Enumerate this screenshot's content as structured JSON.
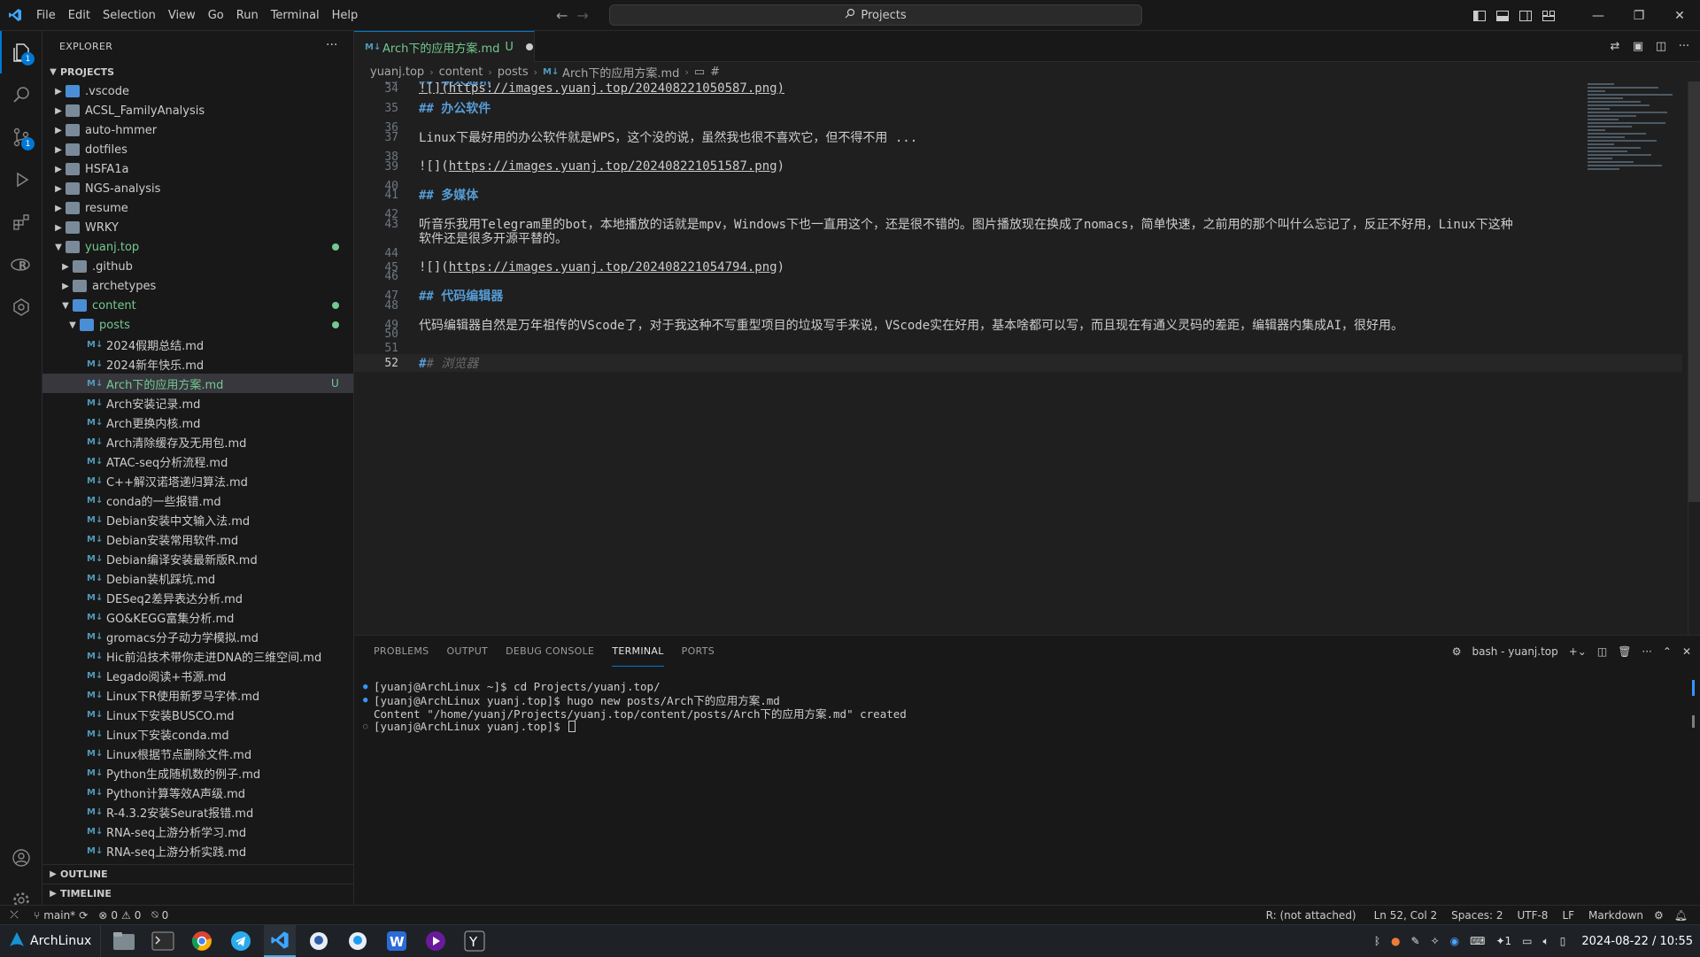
{
  "menu": [
    "File",
    "Edit",
    "Selection",
    "View",
    "Go",
    "Run",
    "Terminal",
    "Help"
  ],
  "command_center": "Projects",
  "explorer": {
    "title": "EXPLORER",
    "section": "PROJECTS",
    "items": [
      {
        "label": ".vscode",
        "type": "folder",
        "depth": 0,
        "open": false,
        "color": "blue"
      },
      {
        "label": "ACSL_FamilyAnalysis",
        "type": "folder",
        "depth": 0,
        "open": false
      },
      {
        "label": "auto-hmmer",
        "type": "folder",
        "depth": 0,
        "open": false
      },
      {
        "label": "dotfiles",
        "type": "folder",
        "depth": 0,
        "open": false
      },
      {
        "label": "HSFA1a",
        "type": "folder",
        "depth": 0,
        "open": false
      },
      {
        "label": "NGS-analysis",
        "type": "folder",
        "depth": 0,
        "open": false
      },
      {
        "label": "resume",
        "type": "folder",
        "depth": 0,
        "open": false
      },
      {
        "label": "WRKY",
        "type": "folder",
        "depth": 0,
        "open": false
      },
      {
        "label": "yuanj.top",
        "type": "folder",
        "depth": 0,
        "open": true,
        "git": true,
        "dot": true
      },
      {
        "label": ".github",
        "type": "folder",
        "depth": 1,
        "open": false
      },
      {
        "label": "archetypes",
        "type": "folder",
        "depth": 1,
        "open": false
      },
      {
        "label": "content",
        "type": "folder",
        "depth": 1,
        "open": true,
        "git": true,
        "dot": true,
        "color": "blue"
      },
      {
        "label": "posts",
        "type": "folder",
        "depth": 2,
        "open": true,
        "git": true,
        "dot": true,
        "color": "blue"
      },
      {
        "label": "2024假期总结.md",
        "type": "md",
        "depth": 3
      },
      {
        "label": "2024新年快乐.md",
        "type": "md",
        "depth": 3
      },
      {
        "label": "Arch下的应用方案.md",
        "type": "md",
        "depth": 3,
        "selected": true,
        "git": true,
        "status": "U"
      },
      {
        "label": "Arch安装记录.md",
        "type": "md",
        "depth": 3
      },
      {
        "label": "Arch更换内核.md",
        "type": "md",
        "depth": 3
      },
      {
        "label": "Arch清除缓存及无用包.md",
        "type": "md",
        "depth": 3
      },
      {
        "label": "ATAC-seq分析流程.md",
        "type": "md",
        "depth": 3
      },
      {
        "label": "C++解汉诺塔递归算法.md",
        "type": "md",
        "depth": 3
      },
      {
        "label": "conda的一些报错.md",
        "type": "md",
        "depth": 3
      },
      {
        "label": "Debian安装中文输入法.md",
        "type": "md",
        "depth": 3
      },
      {
        "label": "Debian安装常用软件.md",
        "type": "md",
        "depth": 3
      },
      {
        "label": "Debian编译安装最新版R.md",
        "type": "md",
        "depth": 3
      },
      {
        "label": "Debian装机踩坑.md",
        "type": "md",
        "depth": 3
      },
      {
        "label": "DESeq2差异表达分析.md",
        "type": "md",
        "depth": 3
      },
      {
        "label": "GO&KEGG富集分析.md",
        "type": "md",
        "depth": 3
      },
      {
        "label": "gromacs分子动力学模拟.md",
        "type": "md",
        "depth": 3
      },
      {
        "label": "Hic前沿技术带你走进DNA的三维空间.md",
        "type": "md",
        "depth": 3
      },
      {
        "label": "Legado阅读+书源.md",
        "type": "md",
        "depth": 3
      },
      {
        "label": "Linux下R使用新罗马字体.md",
        "type": "md",
        "depth": 3
      },
      {
        "label": "Linux下安装BUSCO.md",
        "type": "md",
        "depth": 3
      },
      {
        "label": "Linux下安装conda.md",
        "type": "md",
        "depth": 3
      },
      {
        "label": "Linux根据节点删除文件.md",
        "type": "md",
        "depth": 3
      },
      {
        "label": "Python生成随机数的例子.md",
        "type": "md",
        "depth": 3
      },
      {
        "label": "Python计算等效A声级.md",
        "type": "md",
        "depth": 3
      },
      {
        "label": "R-4.3.2安装Seurat报错.md",
        "type": "md",
        "depth": 3
      },
      {
        "label": "RNA-seq上游分析学习.md",
        "type": "md",
        "depth": 3
      },
      {
        "label": "RNA-seq上游分析实践.md",
        "type": "md",
        "depth": 3
      }
    ],
    "outline": "OUTLINE",
    "timeline": "TIMELINE"
  },
  "tab": {
    "label": "Arch下的应用方案.md",
    "status": "U"
  },
  "breadcrumb": [
    "yuanj.top",
    "content",
    "posts",
    "Arch下的应用方案.md",
    "#"
  ],
  "editor_lines": [
    {
      "n": "25",
      "segs": [
        {
          "t": "## 聊天通讯",
          "c": "hd"
        }
      ]
    },
    {
      "n": "34",
      "segs": [
        {
          "t": "![](https://images.yuanj.top/202408221050587.png)",
          "c": "lnk"
        }
      ]
    },
    {
      "n": "35",
      "segs": [
        {
          "t": "## 办公软件",
          "c": "hd"
        }
      ]
    },
    {
      "n": "36",
      "segs": []
    },
    {
      "n": "37",
      "segs": [
        {
          "t": "Linux下最好用的办公软件就是WPS，这个没的说，虽然我也很不喜欢它，但不得不用 ...",
          "c": ""
        }
      ]
    },
    {
      "n": "38",
      "segs": []
    },
    {
      "n": "39",
      "segs": [
        {
          "t": "![](",
          "c": ""
        },
        {
          "t": "https://images.yuanj.top/202408221051587.png",
          "c": "lnk"
        },
        {
          "t": ")",
          "c": ""
        }
      ]
    },
    {
      "n": "40",
      "segs": []
    },
    {
      "n": "41",
      "segs": [
        {
          "t": "## 多媒体",
          "c": "hd"
        }
      ]
    },
    {
      "n": "42",
      "segs": []
    },
    {
      "n": "43",
      "segs": [
        {
          "t": "听音乐我用Telegram里的bot，本地播放的话就是mpv，Windows下也一直用这个，还是很不错的。图片播放现在换成了nomacs，简单快速，之前用的那个叫什么忘记了，反正不好用，Linux下这种",
          "c": ""
        }
      ]
    },
    {
      "n": "",
      "segs": [
        {
          "t": "软件还是很多开源平替的。",
          "c": ""
        }
      ]
    },
    {
      "n": "44",
      "segs": []
    },
    {
      "n": "45",
      "segs": [
        {
          "t": "![](",
          "c": ""
        },
        {
          "t": "https://images.yuanj.top/202408221054794.png",
          "c": "lnk"
        },
        {
          "t": ")",
          "c": ""
        }
      ]
    },
    {
      "n": "46",
      "segs": []
    },
    {
      "n": "47",
      "segs": [
        {
          "t": "## 代码编辑器",
          "c": "hd"
        }
      ]
    },
    {
      "n": "48",
      "segs": []
    },
    {
      "n": "49",
      "segs": [
        {
          "t": "代码编辑器自然是万年祖传的VScode了，对于我这种不写重型项目的垃圾写手来说，VScode实在好用，基本啥都可以写，而且现在有通义灵码的差距，编辑器内集成AI，很好用。",
          "c": ""
        }
      ]
    },
    {
      "n": "50",
      "segs": []
    },
    {
      "n": "51",
      "segs": []
    },
    {
      "n": "52",
      "segs": [
        {
          "t": "#",
          "c": "hd"
        },
        {
          "t": "# 浏览器",
          "c": "ghost"
        }
      ],
      "current": true
    }
  ],
  "panel": {
    "tabs": [
      "PROBLEMS",
      "OUTPUT",
      "DEBUG CONSOLE",
      "TERMINAL",
      "PORTS"
    ],
    "active": "TERMINAL",
    "terminal_name": "bash - yuanj.top",
    "lines": [
      {
        "mark": "filled",
        "text": "[yuanj@ArchLinux ~]$ cd Projects/yuanj.top/"
      },
      {
        "mark": "filled",
        "text": "[yuanj@ArchLinux yuanj.top]$ hugo new posts/Arch下的应用方案.md"
      },
      {
        "mark": "",
        "text": "Content \"/home/yuanj/Projects/yuanj.top/content/posts/Arch下的应用方案.md\" created"
      },
      {
        "mark": "hollow",
        "text": "[yuanj@ArchLinux yuanj.top]$ ",
        "cursor": true
      }
    ]
  },
  "status": {
    "branch": "main*",
    "errors": "0",
    "warnings": "0",
    "ports": "0",
    "r": "R: (not attached)",
    "position": "Ln 52, Col 2",
    "spaces": "Spaces: 2",
    "encoding": "UTF-8",
    "eol": "LF",
    "language": "Markdown"
  },
  "taskbar": {
    "start_label": "ArchLinux",
    "datetime": "2024-08-22 / 10:55",
    "tray_count": "1"
  },
  "badges": {
    "explorer": "1",
    "scm": "1"
  }
}
